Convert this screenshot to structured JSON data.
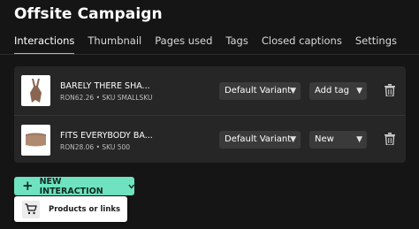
{
  "page": {
    "title": "Offsite Campaign",
    "accent_color": "#6fe3bf"
  },
  "tabs": [
    {
      "label": "Interactions",
      "active": true
    },
    {
      "label": "Thumbnail",
      "active": false
    },
    {
      "label": "Pages used",
      "active": false
    },
    {
      "label": "Tags",
      "active": false
    },
    {
      "label": "Closed captions",
      "active": false
    },
    {
      "label": "Settings",
      "active": false
    }
  ],
  "interactions": [
    {
      "name": "BARELY THERE SHA...",
      "price": "RON62.26",
      "sku": "SKU SMALLSKU",
      "variant": "Default Variant",
      "tag": "Add tag",
      "thumb_color": "#8a6552",
      "delete_icon": "trash-icon"
    },
    {
      "name": "FITS EVERYBODY BA...",
      "price": "RON28.06",
      "sku": "SKU 500",
      "variant": "Default Variant",
      "tag": "New",
      "thumb_color": "#b08a70",
      "delete_icon": "trash-icon"
    }
  ],
  "new_interaction": {
    "label": "NEW INTERACTION",
    "icon": "plus-icon",
    "dropdown_icon": "chevron-down-icon"
  },
  "menu": {
    "item_label": "Products or links",
    "item_icon": "cart-icon"
  }
}
